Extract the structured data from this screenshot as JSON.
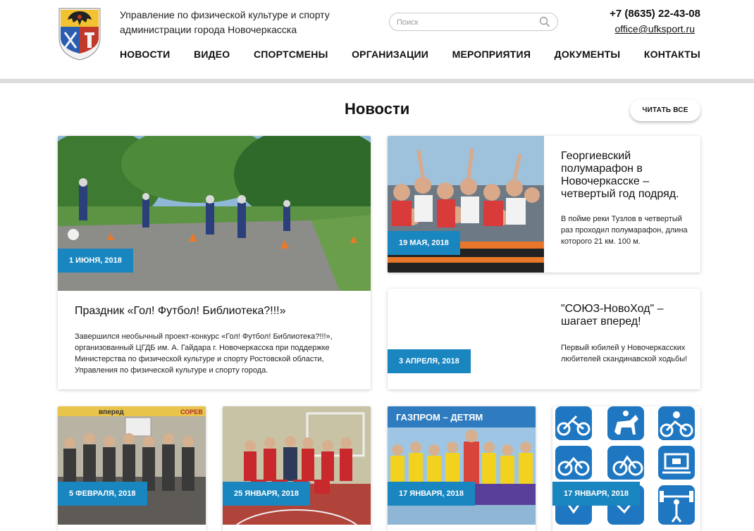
{
  "header": {
    "org_line1": "Управление по физической культуре и спорту",
    "org_line2": "администрации города Новочеркасска",
    "search_placeholder": "Поиск",
    "phone": "+7 (8635) 22-43-08",
    "email": "office@ufksport.ru",
    "nav": [
      "НОВОСТИ",
      "ВИДЕО",
      "СПОРТСМЕНЫ",
      "ОРГАНИЗАЦИИ",
      "МЕРОПРИЯТИЯ",
      "ДОКУМЕНТЫ",
      "КОНТАКТЫ"
    ]
  },
  "section": {
    "title": "Новости",
    "read_all": "ЧИТАТЬ ВСЕ"
  },
  "news": [
    {
      "date": "1 ИЮНЯ, 2018",
      "title": "Праздник «Гол! Футбол! Библиотека?!!!»",
      "text": "Завершился необычный проект-конкурс «Гол! Футбол! Библиотека?!!!», организованный ЦГДБ им. А. Гайдара г. Новочеркасска при поддержке Министерства по физической культуре и спорту Ростовской области, Управления по физической культуре и спорту города."
    },
    {
      "date": "19 МАЯ, 2018",
      "title": "Георгиевский полумарафон в Новочеркасске – четвертый год подряд.",
      "text": "В пойме реки Тузлов в четвертый раз проходил полумарафон, длина которого 21 км. 100 м."
    },
    {
      "date": "3 АПРЕЛЯ, 2018",
      "title": "\"СОЮЗ-НовоХод\" – шагает вперед!",
      "text": "Первый юбилей у Новочеркасских любителей скандинавской ходьбы!"
    },
    {
      "date": "5 ФЕВРАЛЯ, 2018",
      "photo_text": "вперед",
      "photo_text2": "СОРЕВ"
    },
    {
      "date": "25 ЯНВАРЯ, 2018"
    },
    {
      "date": "17 ЯНВАРЯ, 2018",
      "photo_text": "ГАЗПРОМ – ДЕТЯМ"
    },
    {
      "date": "17 ЯНВАРЯ, 2018"
    }
  ],
  "colors": {
    "accent": "#1a86c0",
    "divider": "#dcdcdc",
    "pictogram": "#1f77c2"
  },
  "icons": [
    "search-icon",
    "coat-of-arms-icon",
    "cycling-icon",
    "equestrian-icon",
    "motorsport-icon",
    "paracycling-icon",
    "table-football-icon",
    "weightlifting-icon"
  ]
}
